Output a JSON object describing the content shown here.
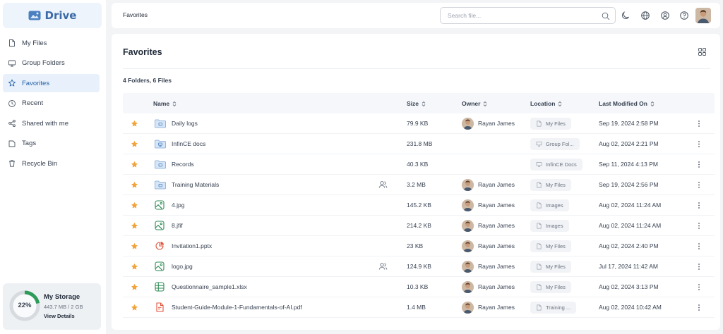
{
  "app": {
    "name": "Drive"
  },
  "sidebar": {
    "items": [
      {
        "label": "My Files",
        "icon": "file-icon",
        "active": false
      },
      {
        "label": "Group Folders",
        "icon": "group-folder-icon",
        "active": false
      },
      {
        "label": "Favorites",
        "icon": "star-icon",
        "active": true
      },
      {
        "label": "Recent",
        "icon": "clock-icon",
        "active": false
      },
      {
        "label": "Shared with me",
        "icon": "share-icon",
        "active": false
      },
      {
        "label": "Tags",
        "icon": "tag-icon",
        "active": false
      },
      {
        "label": "Recycle Bin",
        "icon": "trash-icon",
        "active": false
      }
    ],
    "storage": {
      "percent_label": "22%",
      "percent": 22,
      "title": "My Storage",
      "usage": "443.7 MB / 2 GB",
      "link": "View Details"
    }
  },
  "topbar": {
    "breadcrumb": "Favorites",
    "search_placeholder": "Search file...",
    "icons": [
      "moon-icon",
      "globe-icon",
      "profile-icon",
      "help-icon",
      "user-avatar"
    ]
  },
  "main": {
    "title": "Favorites",
    "summary": "4 Folders, 6 Files",
    "columns": {
      "name": "Name",
      "size": "Size",
      "owner": "Owner",
      "location": "Location",
      "modified": "Last Modified On"
    }
  },
  "colors": {
    "accent": "#2563a8",
    "star": "#f2a33a",
    "storage_ring": "#2e9b5a",
    "folder": "#d6e6f7"
  },
  "rows": [
    {
      "name": "Daily logs",
      "type": "folder",
      "shared": false,
      "size": "79.9 KB",
      "owner": "Rayan James",
      "location": "My Files",
      "location_icon": "file-icon",
      "modified": "Sep 19, 2024 2:58 PM"
    },
    {
      "name": "InfinCE docs",
      "type": "group-folder",
      "shared": false,
      "size": "231.8 MB",
      "owner": "",
      "location": "Group Fol...",
      "location_icon": "group-folder-icon",
      "modified": "Aug 02, 2024 2:21 PM"
    },
    {
      "name": "Records",
      "type": "folder",
      "shared": false,
      "size": "40.3 KB",
      "owner": "",
      "location": "InfinCE Docs",
      "location_icon": "group-folder-icon",
      "modified": "Sep 11, 2024 4:13 PM"
    },
    {
      "name": "Training Materials",
      "type": "folder",
      "shared": true,
      "size": "3.2 MB",
      "owner": "Rayan James",
      "location": "My Files",
      "location_icon": "file-icon",
      "modified": "Sep 19, 2024 2:56 PM"
    },
    {
      "name": "4.jpg",
      "type": "image",
      "shared": false,
      "size": "145.2 KB",
      "owner": "Rayan James",
      "location": "Images",
      "location_icon": "file-icon",
      "modified": "Aug 02, 2024 11:24 AM"
    },
    {
      "name": "8.jfif",
      "type": "image",
      "shared": false,
      "size": "214.2 KB",
      "owner": "Rayan James",
      "location": "Images",
      "location_icon": "file-icon",
      "modified": "Aug 02, 2024 11:24 AM"
    },
    {
      "name": "Invitation1.pptx",
      "type": "pptx",
      "shared": false,
      "size": "23 KB",
      "owner": "Rayan James",
      "location": "My Files",
      "location_icon": "file-icon",
      "modified": "Aug 02, 2024 2:40 PM"
    },
    {
      "name": "logo.jpg",
      "type": "image",
      "shared": true,
      "size": "124.9 KB",
      "owner": "Rayan James",
      "location": "My Files",
      "location_icon": "file-icon",
      "modified": "Jul 17, 2024 11:42 AM"
    },
    {
      "name": "Questionnaire_sample1.xlsx",
      "type": "xlsx",
      "shared": false,
      "size": "10.3 KB",
      "owner": "Rayan James",
      "location": "My Files",
      "location_icon": "file-icon",
      "modified": "Aug 02, 2024 3:13 PM"
    },
    {
      "name": "Student-Guide-Module-1-Fundamentals-of-AI.pdf",
      "type": "pdf",
      "shared": false,
      "size": "1.4 MB",
      "owner": "Rayan James",
      "location": "Training ...",
      "location_icon": "file-icon",
      "modified": "Aug 02, 2024 10:42 AM"
    }
  ]
}
